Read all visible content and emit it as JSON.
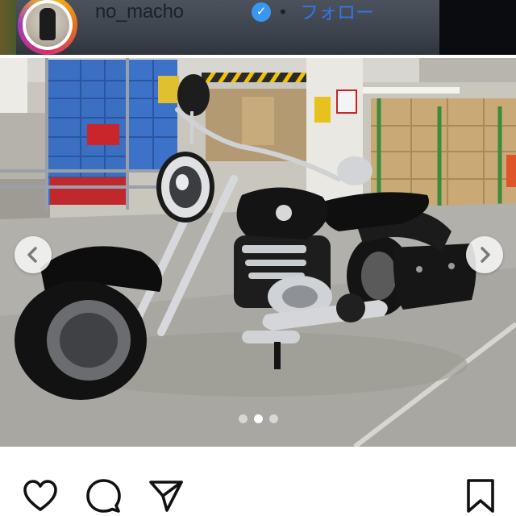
{
  "header": {
    "username": "no_macho",
    "separator": "•",
    "follow_label": "フォロー"
  },
  "post": {
    "photo_subject": "motorcycle-photo",
    "carousel": {
      "total_slides": 3,
      "active_slide": 2
    }
  },
  "actions": {
    "icons": [
      "heart-icon",
      "comment-icon",
      "share-icon",
      "bookmark-icon"
    ]
  },
  "colors": {
    "follow_blue": "#2f78e6",
    "verified_blue": "#3897f0",
    "icon_black": "#111111"
  }
}
